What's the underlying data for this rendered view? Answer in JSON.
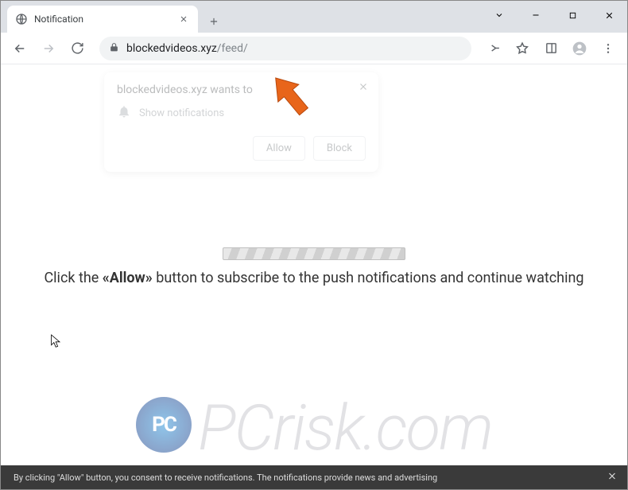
{
  "window": {
    "tab_title": "Notification",
    "url_domain": "blockedvideos.xyz",
    "url_path": "/feed/"
  },
  "popup": {
    "title": "blockedvideos.xyz wants to",
    "row": "Show notifications",
    "allow": "Allow",
    "block": "Block"
  },
  "page": {
    "text_prefix": "Click the ",
    "text_bold": "«Allow»",
    "text_suffix": " button to subscribe to the push notifications and continue watching"
  },
  "watermark": {
    "text": "PCrisk.com"
  },
  "banner": {
    "text": "By clicking \"Allow\" button, you consent to receive notifications. The notifications provide news and advertising"
  }
}
